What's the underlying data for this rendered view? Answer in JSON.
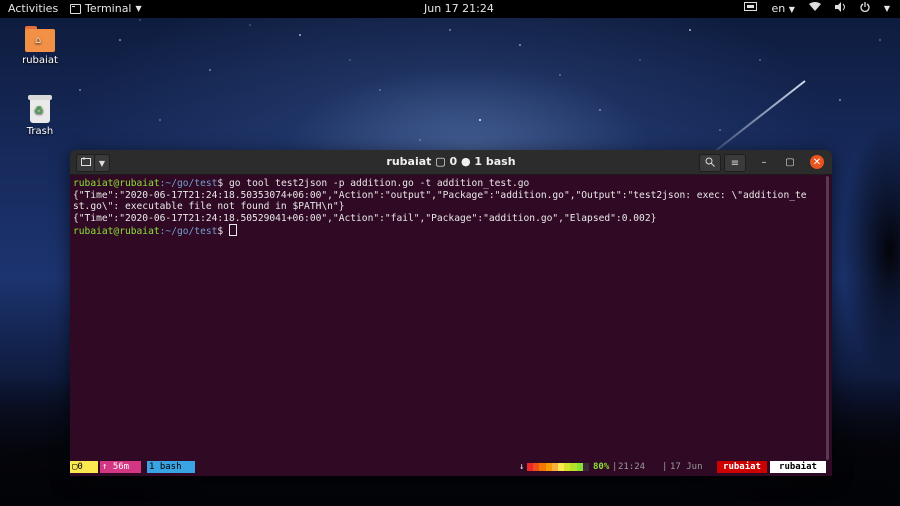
{
  "topbar": {
    "activities": "Activities",
    "app_name": "Terminal",
    "clock": "Jun 17  21:24",
    "language": "en"
  },
  "desktop": {
    "items": [
      {
        "label": "rubaiat",
        "icon": "home-folder-icon"
      },
      {
        "label": "Trash",
        "icon": "trash-icon"
      }
    ]
  },
  "terminal": {
    "title": "rubaiat ▢ 0 ● 1 bash",
    "prompt_user": "rubaiat@rubaiat",
    "prompt_path": ":~/go/test",
    "prompt_symbol": "$ ",
    "command": "go tool test2json -p addition.go -t addition_test.go",
    "output_lines": [
      "{\"Time\":\"2020-06-17T21:24:18.50353074+06:00\",\"Action\":\"output\",\"Package\":\"addition.go\",\"Output\":\"test2json: exec: \\\"addition_te",
      "st.go\\\": executable file not found in $PATH\\n\"}",
      "{\"Time\":\"2020-06-17T21:24:18.50529041+06:00\",\"Action\":\"fail\",\"Package\":\"addition.go\",\"Elapsed\":0.002}"
    ]
  },
  "status_bar": {
    "window": "▢0",
    "uptime": "↑ 56m",
    "session": "1 bash",
    "arrow": "↓",
    "battery_percent": "80%",
    "battery_level": 0.8,
    "separator": "|",
    "time": "21:24",
    "date": "17 Jun",
    "host": "rubaiat",
    "user": "rubaiat"
  },
  "colors": {
    "terminal_bg": "#300a24",
    "prompt_user": "#8ae234",
    "prompt_path": "#729fcf",
    "close_button": "#e95420"
  }
}
